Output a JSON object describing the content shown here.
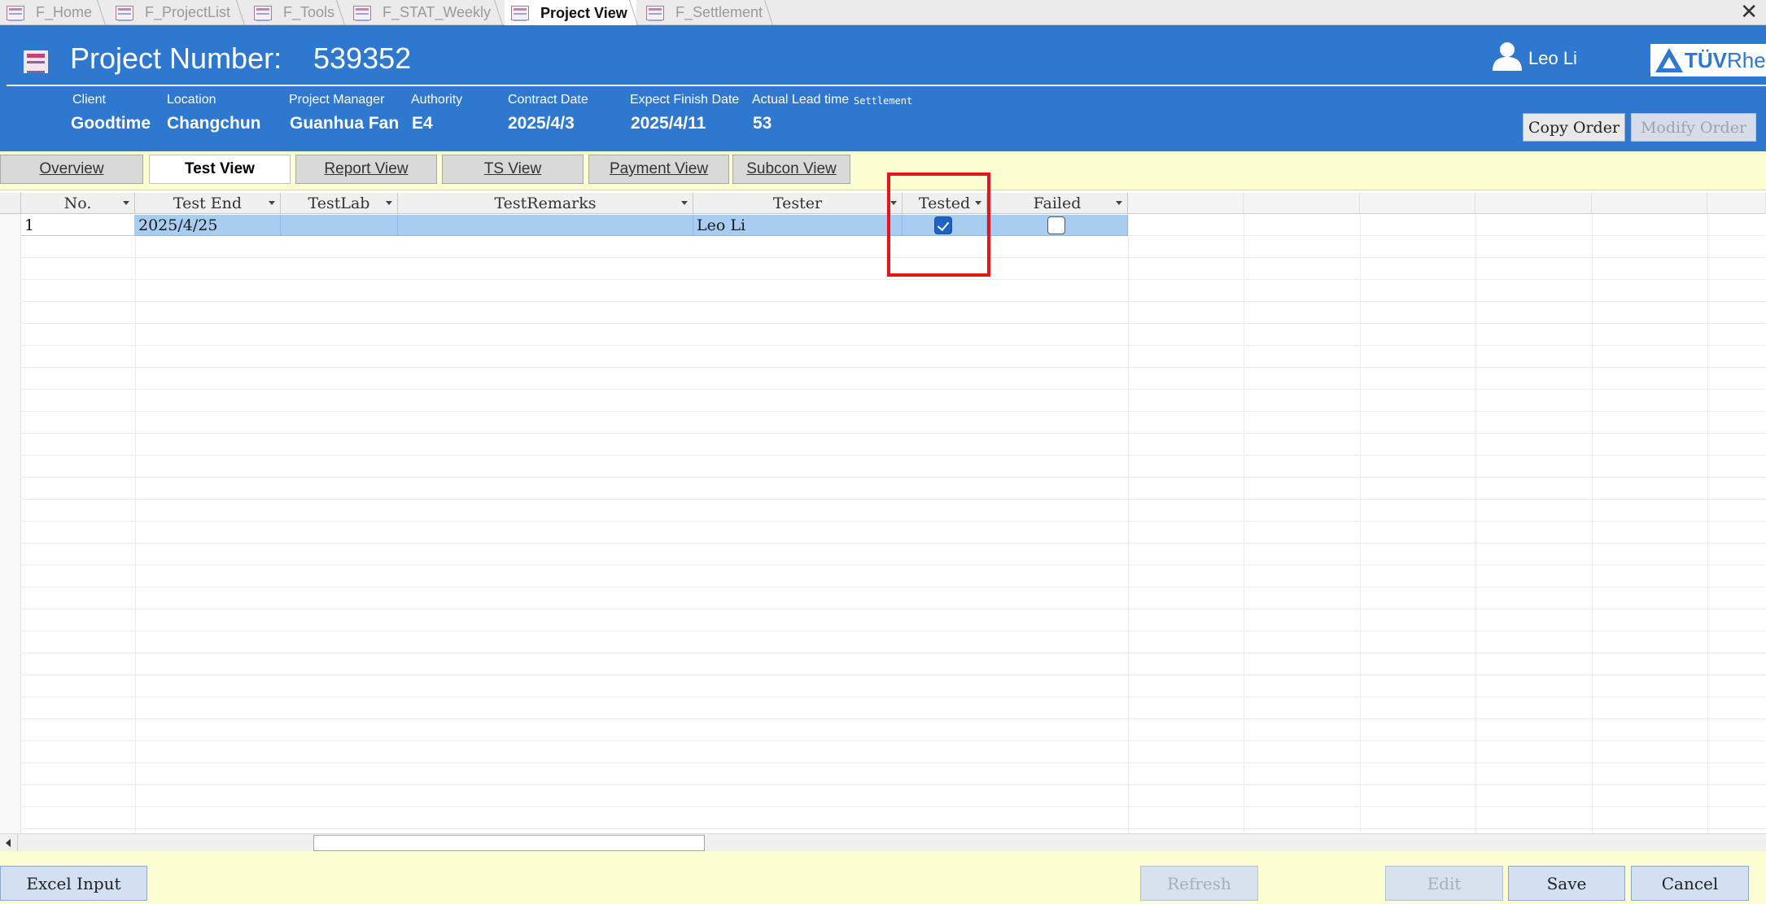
{
  "tabs": [
    {
      "label": "F_Home",
      "active": false
    },
    {
      "label": "F_ProjectList",
      "active": false
    },
    {
      "label": "F_Tools",
      "active": false
    },
    {
      "label": "F_STAT_Weekly",
      "active": false
    },
    {
      "label": "Project View",
      "active": true
    },
    {
      "label": "F_Settlement",
      "active": false
    }
  ],
  "close_glyph": "✕",
  "header": {
    "title_label": "Project Number:",
    "project_number": "539352",
    "user_name": "Leo Li",
    "logo_text_bold": "TÜV",
    "logo_text_rest": "Rheinland",
    "fields": {
      "client": {
        "label": "Client",
        "value": "Goodtime"
      },
      "location": {
        "label": "Location",
        "value": "Changchun"
      },
      "project_manager": {
        "label": "Project Manager",
        "value": "Guanhua Fan"
      },
      "authority": {
        "label": "Authority",
        "value": "E4"
      },
      "contract_date": {
        "label": "Contract Date",
        "value": "2025/4/3"
      },
      "expect_finish_date": {
        "label": "Expect Finish Date",
        "value": "2025/4/11"
      },
      "actual_lead_time": {
        "label": "Actual Lead time",
        "value": "53"
      }
    },
    "settlement_label": "Settlement",
    "copy_order": "Copy Order",
    "modify_order": "Modify Order"
  },
  "view_tabs": [
    {
      "label": "Overview",
      "active": false
    },
    {
      "label": "Test View",
      "active": true
    },
    {
      "label": "Report View",
      "active": false
    },
    {
      "label": "TS View",
      "active": false
    },
    {
      "label": "Payment View",
      "active": false
    },
    {
      "label": "Subcon View",
      "active": false
    }
  ],
  "table": {
    "columns": [
      "No.",
      "Test End",
      "TestLab",
      "TestRemarks",
      "Tester",
      "Tested",
      "Failed"
    ],
    "rows": [
      {
        "no": "1",
        "test_end": "2025/4/25",
        "testlab": "",
        "testremarks": "",
        "tester": "Leo Li",
        "tested": true,
        "failed": false
      }
    ]
  },
  "footer": {
    "excel_input": "Excel Input",
    "refresh": "Refresh",
    "edit": "Edit",
    "save": "Save",
    "cancel": "Cancel"
  },
  "colors": {
    "header_blue": "#2f78d0",
    "band_yellow": "#fdfdd2",
    "selected_row": "#a9cdf0",
    "highlight_red": "#e8141a"
  }
}
